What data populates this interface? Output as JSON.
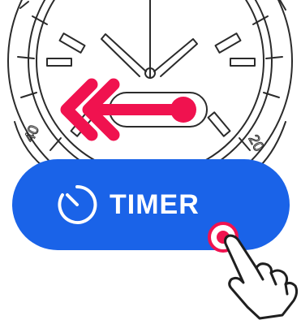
{
  "bezel_numerals": [
    "40",
    "20"
  ],
  "timer_button": {
    "label": "TIMER",
    "accent_color": "#1a63e8",
    "icon": "stopwatch-icon"
  },
  "swipe_arrow": {
    "direction": "left",
    "color": "#f0124f"
  },
  "touch": {
    "icon": "pointing-hand-icon",
    "indicator_color": "#f0124f"
  }
}
